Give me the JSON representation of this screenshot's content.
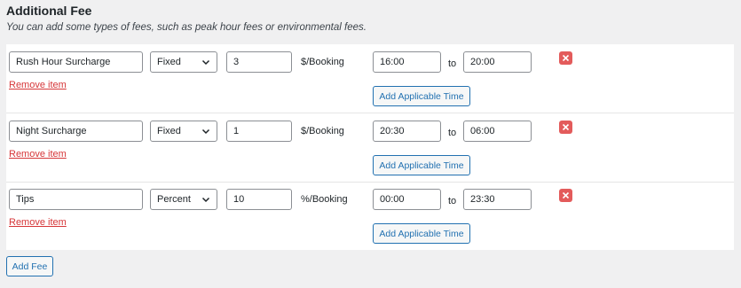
{
  "section": {
    "title": "Additional Fee",
    "description": "You can add some types of fees, such as peak hour fees or environmental fees."
  },
  "fees": [
    {
      "name": "Rush Hour Surcharge",
      "type": "Fixed",
      "amount": "3",
      "unit": "$/Booking",
      "time_from": "16:00",
      "to_label": "to",
      "time_to": "20:00",
      "remove_label": "Remove item",
      "add_time_label": "Add Applicable Time"
    },
    {
      "name": "Night Surcharge",
      "type": "Fixed",
      "amount": "1",
      "unit": "$/Booking",
      "time_from": "20:30",
      "to_label": "to",
      "time_to": "06:00",
      "remove_label": "Remove item",
      "add_time_label": "Add Applicable Time"
    },
    {
      "name": "Tips",
      "type": "Percent",
      "amount": "10",
      "unit": "%/Booking",
      "time_from": "00:00",
      "to_label": "to",
      "time_to": "23:30",
      "remove_label": "Remove item",
      "add_time_label": "Add Applicable Time"
    }
  ],
  "add_fee_label": "Add Fee",
  "colors": {
    "page_bg": "#f0f0f1",
    "panel_bg": "#ffffff",
    "primary": "#2271b1",
    "danger": "#d63638",
    "delete_bg": "#e35b5b"
  },
  "icons": {
    "select_arrow": "chevron-down-icon",
    "delete": "close-icon"
  }
}
